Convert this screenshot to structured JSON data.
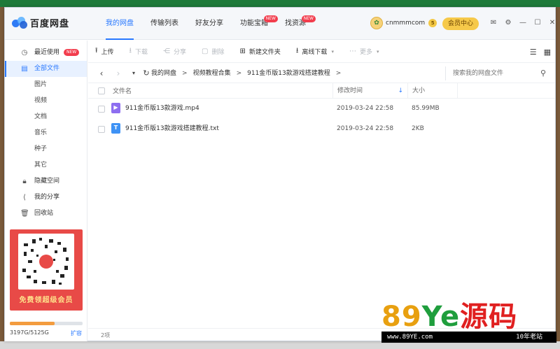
{
  "app": {
    "title": "百度网盘",
    "nav_tabs": [
      {
        "label": "我的网盘",
        "active": true
      },
      {
        "label": "传输列表"
      },
      {
        "label": "好友分享"
      },
      {
        "label": "功能宝箱",
        "badge": "NEW"
      },
      {
        "label": "找资源",
        "badge": "NEW"
      }
    ],
    "user": {
      "name": "cnmmmcom",
      "vip_level": "5"
    },
    "member_center": "会员中心"
  },
  "sidebar": {
    "items": [
      {
        "label": "最近使用",
        "badge": "NEW",
        "icon": "clock-icon"
      },
      {
        "label": "全部文件",
        "active": true,
        "icon": "document-icon"
      },
      {
        "label": "图片"
      },
      {
        "label": "视频"
      },
      {
        "label": "文档"
      },
      {
        "label": "音乐"
      },
      {
        "label": "种子"
      },
      {
        "label": "其它"
      },
      {
        "label": "隐藏空间",
        "icon": "lock-icon"
      },
      {
        "label": "我的分享",
        "icon": "share-icon"
      },
      {
        "label": "回收站",
        "icon": "trash-icon"
      }
    ],
    "promo": {
      "text": "免费领超级会员"
    },
    "quota": {
      "text": "3197G/5125G",
      "used_fraction": 0.62,
      "expand": "扩容"
    }
  },
  "toolbar": {
    "buttons": [
      {
        "label": "上传",
        "icon": "upload-icon",
        "enabled": true
      },
      {
        "label": "下载",
        "icon": "download-icon",
        "enabled": false
      },
      {
        "label": "分享",
        "icon": "share-icon",
        "enabled": false
      },
      {
        "label": "删除",
        "icon": "trash-icon",
        "enabled": false
      },
      {
        "label": "新建文件夹",
        "icon": "new-folder-icon",
        "enabled": true
      },
      {
        "label": "离线下载",
        "icon": "offline-download-icon",
        "enabled": true
      },
      {
        "label": "更多",
        "icon": "more-icon",
        "enabled": false
      }
    ]
  },
  "addressbar": {
    "breadcrumbs": [
      "我的网盘",
      "视频教程合集",
      "911金币版13款游戏搭建教程"
    ],
    "search_placeholder": "搜索我的网盘文件"
  },
  "table": {
    "headers": {
      "name": "文件名",
      "time": "修改时间",
      "size": "大小"
    },
    "rows": [
      {
        "type": "video",
        "name": "911金币版13款游戏.mp4",
        "time": "2019-03-24 22:58",
        "size": "85.99MB"
      },
      {
        "type": "txt",
        "name": "911金币版13款游戏搭建教程.txt",
        "time": "2019-03-24 22:58",
        "size": "2KB"
      }
    ],
    "count": "2项"
  },
  "watermark": {
    "main_a": "89",
    "main_b": "Ye",
    "main_c": "源码",
    "sub": "www.89YE.com",
    "sub_right": "10年老站"
  },
  "colors": {
    "accent": "#2878ff",
    "badge": "#f23d4d",
    "member": "#f6c94a",
    "quota": "#f39c3f"
  }
}
